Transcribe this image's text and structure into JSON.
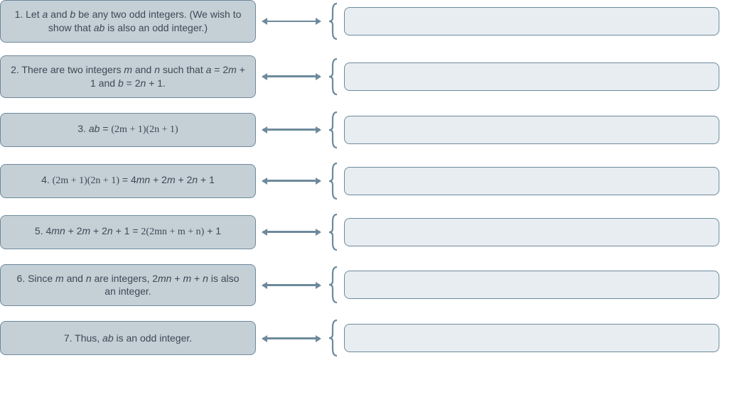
{
  "rows": [
    {
      "parts": [
        {
          "t": "1. Let "
        },
        {
          "t": "a",
          "it": true
        },
        {
          "t": " and "
        },
        {
          "t": "b",
          "it": true
        },
        {
          "t": " be any two odd integers. (We wish to show that "
        },
        {
          "t": "ab",
          "it": true
        },
        {
          "t": " is also an odd integer.)"
        }
      ]
    },
    {
      "parts": [
        {
          "t": "2. There are two integers "
        },
        {
          "t": "m",
          "it": true
        },
        {
          "t": " and "
        },
        {
          "t": "n",
          "it": true
        },
        {
          "t": "  such that "
        },
        {
          "t": "a",
          "it": true
        },
        {
          "t": " = 2"
        },
        {
          "t": "m",
          "it": true
        },
        {
          "t": " + 1 and "
        },
        {
          "t": "b",
          "it": true
        },
        {
          "t": " = 2"
        },
        {
          "t": "n",
          "it": true
        },
        {
          "t": " + 1."
        }
      ]
    },
    {
      "parts": [
        {
          "t": "3. "
        },
        {
          "t": "ab",
          "it": true
        },
        {
          "t": " = "
        },
        {
          "t": "(2m + 1)(2n + 1)",
          "serif": true
        }
      ]
    },
    {
      "parts": [
        {
          "t": "4. "
        },
        {
          "t": "(2m + 1)(2n + 1)",
          "serif": true
        },
        {
          "t": " = 4"
        },
        {
          "t": "mn",
          "it": true
        },
        {
          "t": " + 2"
        },
        {
          "t": "m",
          "it": true
        },
        {
          "t": " + 2"
        },
        {
          "t": "n",
          "it": true
        },
        {
          "t": " + 1"
        }
      ]
    },
    {
      "parts": [
        {
          "t": "5. 4"
        },
        {
          "t": "mn",
          "it": true
        },
        {
          "t": " + 2"
        },
        {
          "t": "m",
          "it": true
        },
        {
          "t": " + 2"
        },
        {
          "t": "n",
          "it": true
        },
        {
          "t": " + 1 = "
        },
        {
          "t": "2(2mn + m + n)",
          "serif": true
        },
        {
          "t": " + 1"
        }
      ]
    },
    {
      "parts": [
        {
          "t": "6. Since "
        },
        {
          "t": "m",
          "it": true
        },
        {
          "t": " and "
        },
        {
          "t": "n",
          "it": true
        },
        {
          "t": " are integers, 2"
        },
        {
          "t": "mn",
          "it": true
        },
        {
          "t": " + "
        },
        {
          "t": "m",
          "it": true
        },
        {
          "t": " + "
        },
        {
          "t": "n",
          "it": true
        },
        {
          "t": " is also an integer."
        }
      ]
    },
    {
      "parts": [
        {
          "t": "7. Thus, "
        },
        {
          "t": "ab",
          "it": true
        },
        {
          "t": " is an odd integer."
        }
      ]
    }
  ]
}
